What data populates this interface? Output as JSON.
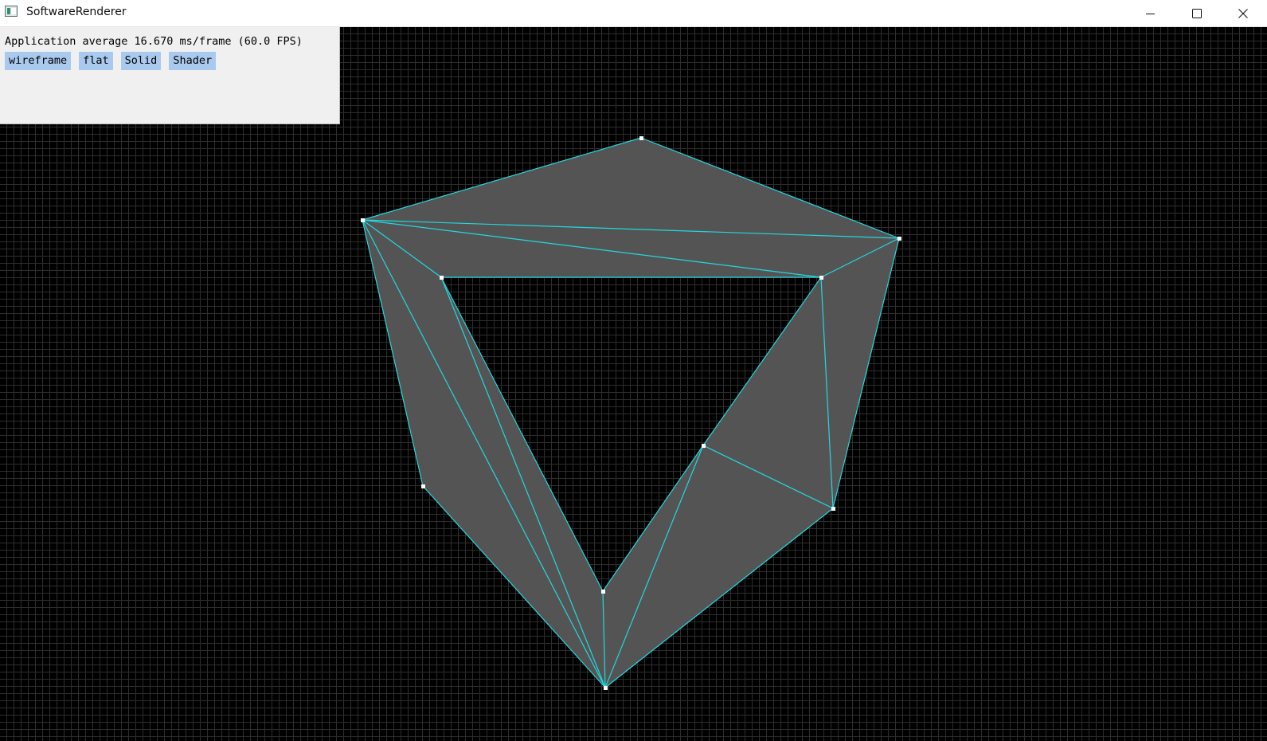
{
  "window": {
    "title": "SoftwareRenderer",
    "icon": "app-window-icon",
    "controls": {
      "minimize_icon": "minimize-icon",
      "maximize_icon": "maximize-icon",
      "close_icon": "close-icon"
    }
  },
  "overlay": {
    "perf_text": "Application average 16.670 ms/frame (60.0 FPS)",
    "buttons": [
      {
        "label": "wireframe"
      },
      {
        "label": "flat"
      },
      {
        "label": "Solid"
      },
      {
        "label": "Shader"
      }
    ]
  },
  "colors": {
    "background": "#000000",
    "grid": "#2e2e2e",
    "fill": "#545454",
    "edge": "#22d8e0",
    "vertex": "#ffffff",
    "button": "#a9c9ef",
    "panel": "#f0f0f0"
  }
}
